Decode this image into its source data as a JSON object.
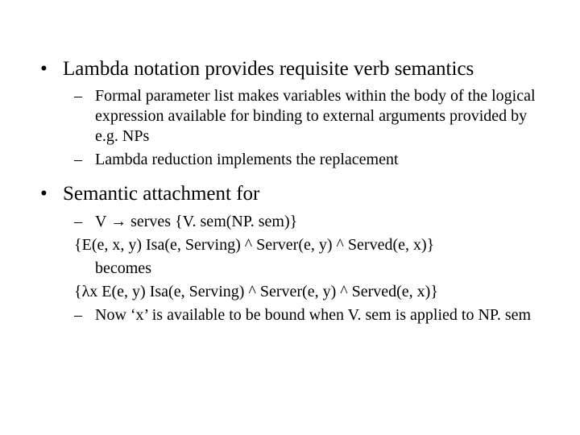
{
  "bullets": {
    "l1a": "Lambda notation provides requisite verb semantics",
    "l2a": "Formal parameter list makes variables within the body of the logical expression available for binding to external arguments provided by e.g. NPs",
    "l2b": "Lambda reduction implements the replacement",
    "l1b": "Semantic attachment for",
    "l2c": "V → serves {V. sem(NP. sem)}",
    "expr1": "{E(e, x, y) Isa(e, Serving) ^ Server(e, y) ^ Served(e, x)}",
    "becomes": "becomes",
    "expr2": "{λx  E(e, y) Isa(e, Serving) ^ Server(e, y) ^ Served(e, x)}",
    "l2d": "Now ‘x’ is available to be bound when V. sem is applied to NP. sem"
  }
}
